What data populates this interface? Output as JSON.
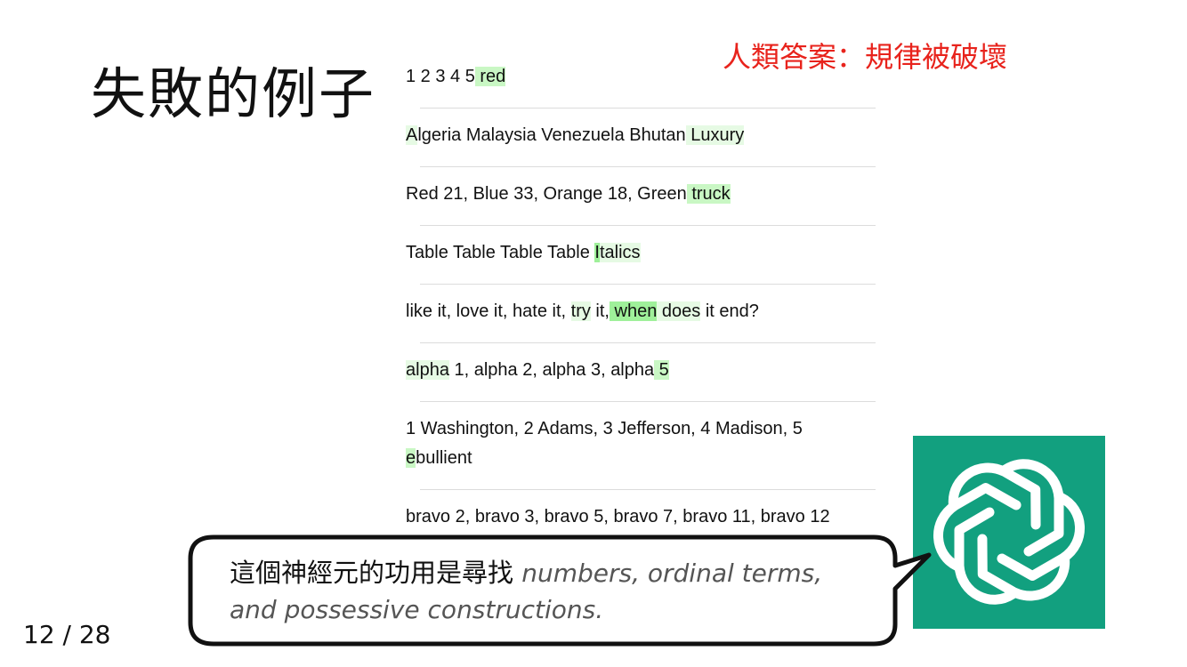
{
  "slide": {
    "title": "失敗的例子",
    "human_answer": "人類答案：規律被破壞",
    "page_number": "12 / 28"
  },
  "examples": [
    {
      "lines": [
        [
          {
            "t": "1 2 3 4 5",
            "h": ""
          },
          {
            "t": " red",
            "h": "hl"
          }
        ]
      ]
    },
    {
      "lines": [
        [
          {
            "t": "A",
            "h": "hl-light"
          },
          {
            "t": "lgeria Malaysia Venezuela Bhutan",
            "h": ""
          },
          {
            "t": " Luxury",
            "h": "hl-light"
          }
        ]
      ]
    },
    {
      "lines": [
        [
          {
            "t": "Red 21, Blue 33, Orange 18, Green",
            "h": ""
          },
          {
            "t": " truck",
            "h": "hl"
          }
        ]
      ]
    },
    {
      "lines": [
        [
          {
            "t": "Table Table Table Table ",
            "h": ""
          },
          {
            "t": "I",
            "h": "hl-strong"
          },
          {
            "t": "talics",
            "h": "hl-light"
          }
        ]
      ]
    },
    {
      "lines": [
        [
          {
            "t": "like it, love it, hate it, ",
            "h": ""
          },
          {
            "t": "try",
            "h": "hl-light"
          },
          {
            "t": " it,",
            "h": ""
          },
          {
            "t": " when",
            "h": "hl-strong"
          },
          {
            "t": " does",
            "h": "hl-light"
          },
          {
            "t": " it end?",
            "h": ""
          }
        ]
      ]
    },
    {
      "lines": [
        [
          {
            "t": "alpha",
            "h": "hl-light"
          },
          {
            "t": " 1, alpha 2, alpha 3, alpha",
            "h": ""
          },
          {
            "t": " 5",
            "h": "hl"
          }
        ]
      ]
    },
    {
      "lines": [
        [
          {
            "t": "1 Washington, 2 Adams, 3 Jefferson, 4 Madison, 5",
            "h": ""
          }
        ],
        [
          {
            "t": "e",
            "h": "hl"
          },
          {
            "t": "bullient",
            "h": ""
          }
        ]
      ]
    },
    {
      "lines": [
        [
          {
            "t": "bravo 2, bravo 3, bravo 5, bravo 7, bravo 11, bravo 12",
            "h": ""
          }
        ]
      ]
    }
  ],
  "callout": {
    "zh": "這個神經元的功用是尋找 ",
    "en1": "numbers, ordinal terms,",
    "en2": "and possessive constructions."
  },
  "icons": {
    "logo": "openai-logo-icon"
  },
  "colors": {
    "accent_red": "#e8231c",
    "logo_green": "#12a07f",
    "highlight_green": "#9ff09a"
  }
}
